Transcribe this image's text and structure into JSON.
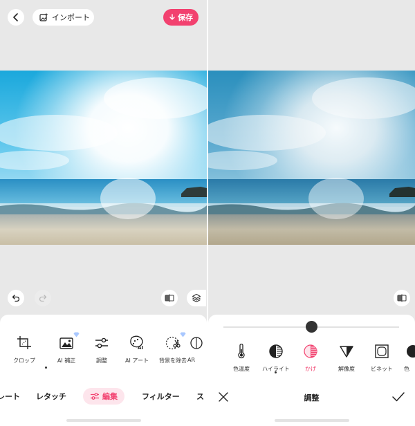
{
  "left": {
    "import_label": "インポート",
    "save_label": "保存",
    "tools": [
      {
        "label": "クロップ",
        "icon": "crop-icon"
      },
      {
        "label": "AI 補正",
        "icon": "ai-enhance-icon",
        "badge": "diamond"
      },
      {
        "label": "調整",
        "icon": "sliders-icon"
      },
      {
        "label": "AI アート",
        "icon": "ai-art-icon"
      },
      {
        "label": "背景を除去",
        "icon": "remove-background-icon",
        "badge": "diamond"
      },
      {
        "label": "AR",
        "icon": "ar-icon"
      }
    ],
    "tabs": [
      {
        "label": "レート"
      },
      {
        "label": "レタッチ"
      },
      {
        "label": "編集",
        "active": true
      },
      {
        "label": "フィルター"
      },
      {
        "label": "ス"
      }
    ]
  },
  "right": {
    "adjust_tools": [
      {
        "label": "色温度",
        "icon": "thermometer-icon"
      },
      {
        "label": "ハイライト",
        "icon": "highlight-icon"
      },
      {
        "label": "かげ",
        "icon": "shadow-icon",
        "active": true
      },
      {
        "label": "解像度",
        "icon": "sharpness-icon"
      },
      {
        "label": "ビネット",
        "icon": "vignette-icon"
      },
      {
        "label": "色",
        "icon": "color-icon"
      }
    ],
    "title": "調整",
    "slider_value": 0.5
  },
  "colors": {
    "accent": "#f2416f",
    "accent_soft": "#fde5ec"
  }
}
